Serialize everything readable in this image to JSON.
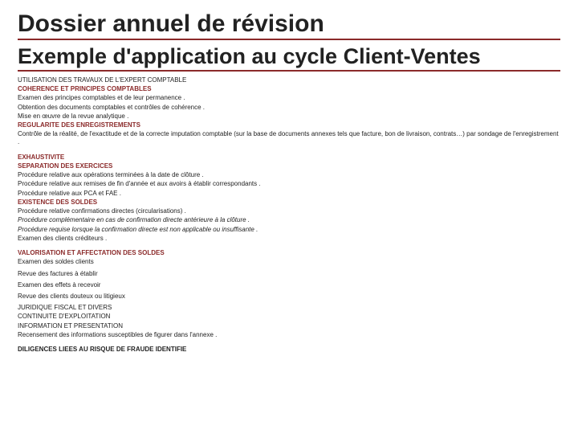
{
  "title1": "Dossier annuel de révision",
  "title2": "Exemple d'application au cycle Client-Ventes",
  "lines": {
    "l0": "UTILISATION DES TRAVAUX DE L'EXPERT COMPTABLE",
    "l1": "COHERENCE ET PRINCIPES COMPTABLES",
    "l2": "Examen des principes comptables et de leur permanence .",
    "l3": "Obtention des documents comptables et contrôles de cohérence .",
    "l4": "Mise en œuvre de la revue analytique .",
    "l5": "REGULARITE DES ENREGISTREMENTS",
    "l6": "Contrôle de la réalité, de l'exactitude et de la correcte imputation comptable (sur la base de documents annexes tels que facture, bon de livraison, contrats…) par sondage de l'enregistrement .",
    "l7": "EXHAUSTIVITE",
    "l8": "SEPARATION DES EXERCICES",
    "l9": "Procédure relative aux opérations terminées à la date de clôture .",
    "l10": "Procédure relative aux remises de fin d'année et aux avoirs à établir correspondants .",
    "l11": "Procédure relative aux PCA et FAE .",
    "l12": "EXISTENCE DES SOLDES",
    "l13": "Procédure relative confirmations directes (circularisations) .",
    "l14": "Procédure complémentaire en cas de confirmation directe antérieure à la clôture .",
    "l15": "Procédure requise lorsque la confirmation directe est non applicable ou insuffisante .",
    "l16": "Examen des clients créditeurs .",
    "l17": "VALORISATION ET AFFECTATION DES SOLDES",
    "l18": "Examen des soldes clients",
    "l19": "Revue des factures à établir",
    "l20": "Examen des effets à recevoir",
    "l21": "Revue des clients douteux ou litigieux",
    "l22": "JURIDIQUE FISCAL ET DIVERS",
    "l23": "CONTINUITE D'EXPLOITATION",
    "l24": "INFORMATION ET PRESENTATION",
    "l25": "Recensement des informations susceptibles de figurer dans l'annexe .",
    "l26": "DILIGENCES LIEES AU RISQUE DE FRAUDE IDENTIFIE"
  }
}
